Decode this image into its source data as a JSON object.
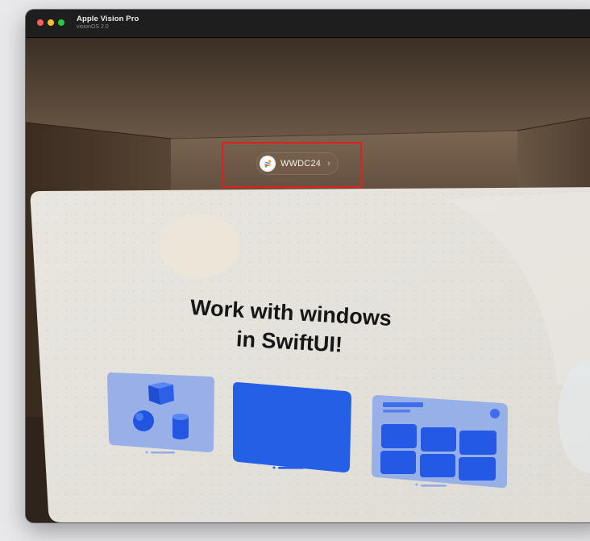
{
  "window": {
    "title": "Apple Vision Pro",
    "subtitle": "visionOS 2.0"
  },
  "ornament": {
    "label": "WWDC24",
    "chevron": "›",
    "icon": "swift-logo-icon"
  },
  "panel": {
    "headline_line1": "Work with windows",
    "headline_line2": "in SwiftUI!",
    "cards": [
      {
        "name": "volume-card",
        "icon": "3d-shapes-icon"
      },
      {
        "name": "window-card",
        "icon": "window-icon"
      },
      {
        "name": "dashboard-card",
        "icon": "grid-layout-icon"
      }
    ]
  },
  "colors": {
    "accent_blue": "#2a5ee8",
    "highlight_red": "#e0201b",
    "panel_bg": "#e6e2dc",
    "close": "#ff5f57",
    "minimize": "#febc2e",
    "maximize": "#28c840"
  }
}
